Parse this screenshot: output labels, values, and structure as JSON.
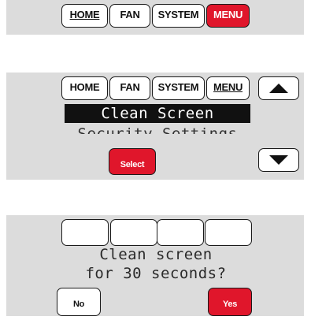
{
  "screen1": {
    "home_label": "HOME",
    "fan_label": "FAN",
    "system_label": "SYSTEM",
    "menu_label": "MENU"
  },
  "screen2": {
    "home_label": "HOME",
    "fan_label": "FAN",
    "system_label": "SYSTEM",
    "menu_label": "MENU",
    "menu_items": [
      "Clean Screen",
      "Security Settings"
    ],
    "select_label": "Select",
    "up_icon": "arrow-up-icon",
    "down_icon": "arrow-down-icon"
  },
  "screen3": {
    "prompt_line1": "Clean screen",
    "prompt_line2": "for 30 seconds?",
    "no_label": "No",
    "yes_label": "Yes"
  },
  "colors": {
    "panel_bg": "#dcdcdc",
    "accent_red": "#e0162b",
    "highlight_bg": "#111111"
  }
}
